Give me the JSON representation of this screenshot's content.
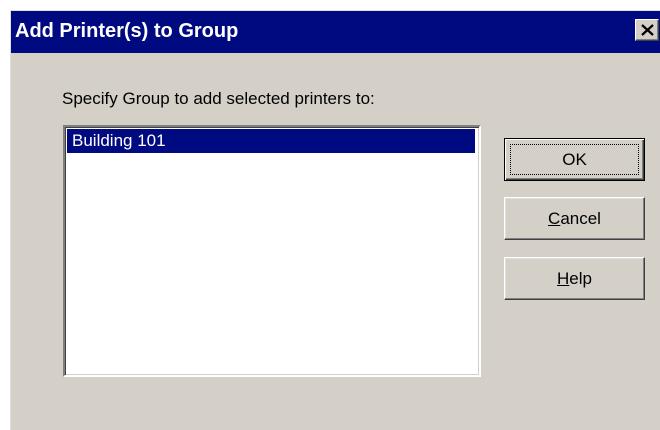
{
  "dialog": {
    "title": "Add Printer(s) to Group",
    "prompt": "Specify Group to add selected printers to:",
    "groups": [
      {
        "label": "Building 101",
        "selected": true
      }
    ],
    "buttons": {
      "ok": {
        "label": "OK"
      },
      "cancel": {
        "first": "C",
        "rest": "ancel"
      },
      "help": {
        "first": "H",
        "rest": "elp"
      }
    },
    "colors": {
      "titlebar": "#000a80",
      "face": "#d4d0c8",
      "selection": "#000a80"
    },
    "icons": {
      "close": "close-icon"
    }
  }
}
